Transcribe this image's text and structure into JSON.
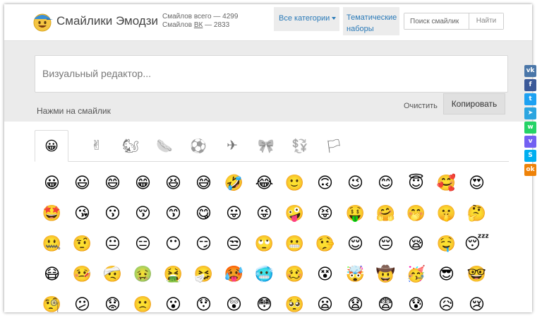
{
  "header": {
    "title": "Смайлики Эмодзи",
    "stats_total": "Смайлов всего — 4299",
    "stats_vk_prefix": "Смайлов ",
    "stats_vk_word": "ВК",
    "stats_vk_suffix": " — 2833",
    "nav_categories": "Все категории",
    "nav_themes_line1": "Тематические",
    "nav_themes_line2": "наборы",
    "search_placeholder": "Поиск смайлик",
    "search_button": "Найти"
  },
  "editor": {
    "placeholder": "Визуальный редактор...",
    "hint": "Нажми на смайлик",
    "clear_label": "Очистить",
    "copy_label": "Копировать"
  },
  "tabs": [
    {
      "icon": "😀",
      "name": "smileys"
    },
    {
      "icon": "✌",
      "name": "people"
    },
    {
      "icon": "🐿",
      "name": "animals"
    },
    {
      "icon": "🌭",
      "name": "food"
    },
    {
      "icon": "⚽",
      "name": "sports"
    },
    {
      "icon": "✈",
      "name": "travel"
    },
    {
      "icon": "🎀",
      "name": "objects"
    },
    {
      "icon": "💱",
      "name": "symbols"
    },
    {
      "icon": "🏳",
      "name": "flags"
    }
  ],
  "emoji_rows": [
    [
      "😀",
      "😃",
      "😄",
      "😁",
      "😆",
      "😅",
      "🤣",
      "😂",
      "🙂",
      "🙃",
      "😉",
      "😊",
      "😇",
      "🥰",
      "😍"
    ],
    [
      "🤩",
      "😘",
      "😗",
      "😚",
      "😙",
      "😋",
      "😛",
      "😜",
      "🤪",
      "😝",
      "🤑",
      "🤗",
      "🤭",
      "🤫",
      "🤔"
    ],
    [
      "🤐",
      "🤨",
      "😐",
      "😑",
      "😶",
      "😏",
      "😒",
      "🙄",
      "😬",
      "🤥",
      "😌",
      "😔",
      "😪",
      "🤤",
      "😴"
    ],
    [
      "😷",
      "🤒",
      "🤕",
      "🤢",
      "🤮",
      "🤧",
      "🥵",
      "🥶",
      "🥴",
      "😵",
      "🤯",
      "🤠",
      "🥳",
      "😎",
      "🤓"
    ],
    [
      "🧐",
      "😕",
      "😟",
      "🙁",
      "😮",
      "😯",
      "😲",
      "😳",
      "🥺",
      "😦",
      "😧",
      "😨",
      "😰",
      "😥",
      "😢"
    ]
  ],
  "social": [
    {
      "label": "vk",
      "glyph": "vk",
      "color": "#4a76a8"
    },
    {
      "label": "facebook",
      "glyph": "f",
      "color": "#3b5998"
    },
    {
      "label": "twitter",
      "glyph": "t",
      "color": "#1da1f2"
    },
    {
      "label": "telegram",
      "glyph": "➤",
      "color": "#2ca5e0"
    },
    {
      "label": "whatsapp",
      "glyph": "w",
      "color": "#25d366"
    },
    {
      "label": "viber",
      "glyph": "v",
      "color": "#7360f2"
    },
    {
      "label": "skype",
      "glyph": "S",
      "color": "#00aff0"
    },
    {
      "label": "odnoklassniki",
      "glyph": "ok",
      "color": "#ee8208"
    }
  ]
}
